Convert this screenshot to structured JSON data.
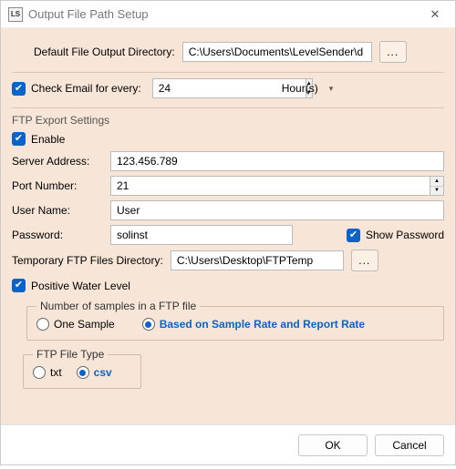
{
  "window": {
    "icon_text": "LS",
    "title": "Output File Path Setup"
  },
  "defaultDir": {
    "label": "Default File Output Directory:",
    "value": "C:\\Users\\Documents\\LevelSender\\d"
  },
  "checkEmail": {
    "label": "Check Email for every:",
    "value": "24",
    "unit": "Hour(s)"
  },
  "ftp": {
    "section_title": "FTP Export Settings",
    "enable_label": "Enable",
    "server_label": "Server Address:",
    "server_value": "123.456.789",
    "port_label": "Port Number:",
    "port_value": "21",
    "user_label": "User Name:",
    "user_value": "User",
    "pass_label": "Password:",
    "pass_value": "solinst",
    "showpass_label": "Show Password",
    "tmpdir_label": "Temporary FTP Files Directory:",
    "tmpdir_value": "C:\\Users\\Desktop\\FTPTemp",
    "pwl_label": "Positive Water Level",
    "samples_legend": "Number of samples in a FTP file",
    "one_sample_label": "One Sample",
    "based_label": "Based on Sample Rate and Report Rate",
    "ftype_legend": "FTP File Type",
    "txt_label": "txt",
    "csv_label": "csv"
  },
  "footer": {
    "ok": "OK",
    "cancel": "Cancel"
  }
}
